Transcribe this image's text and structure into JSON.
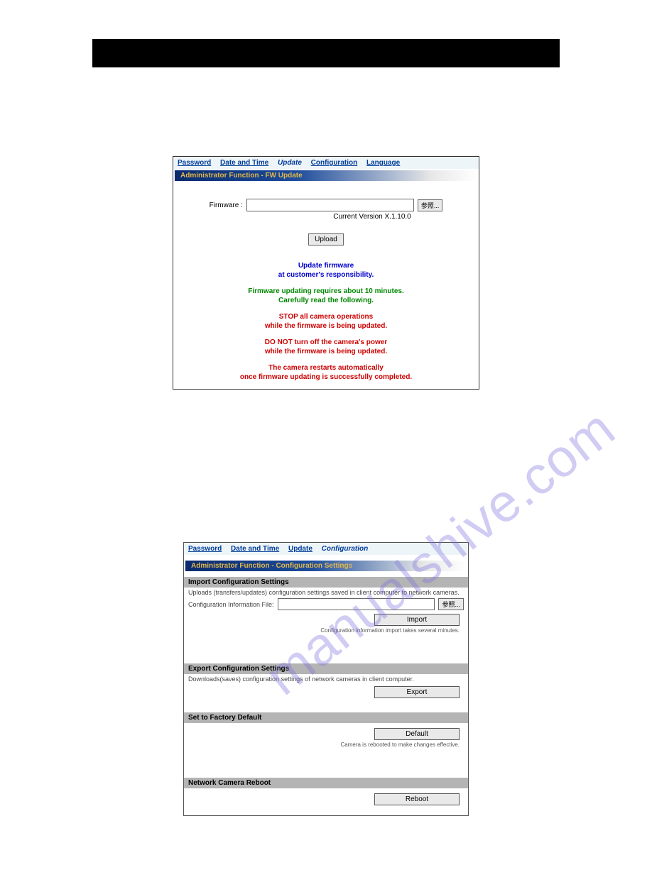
{
  "watermark": "manualshive.com",
  "panel1": {
    "tabs": [
      "Password",
      "Date and Time",
      "Update",
      "Configuration",
      "Language"
    ],
    "active_tab_index": 2,
    "header": "Administrator Function - FW Update",
    "firmware_label": "Firmware :",
    "browse_btn": "参照...",
    "version": "Current Version X.1.10.0",
    "upload_btn": "Upload",
    "msg_blue": "Update firmware\nat customer's responsibility.",
    "msg_green": "Firmware updating requires about 10 minutes.\nCarefully read the following.",
    "msg_red1": "STOP all camera operations\nwhile the firmware is being updated.",
    "msg_red2": "DO NOT turn off the camera's power\nwhile the firmware is being updated.",
    "msg_red3": "The camera restarts automatically\nonce firmware updating is successfully completed."
  },
  "panel2": {
    "tabs": [
      "Password",
      "Date and Time",
      "Update",
      "Configuration"
    ],
    "active_tab_index": 3,
    "header": "Administrator Function - Configuration Settings",
    "import_header": "Import Configuration Settings",
    "import_desc": "Uploads (transfers/updates) configuration settings saved in client computer to network cameras.",
    "config_file_label": "Configuration Information File:",
    "browse_btn": "参照...",
    "import_btn": "Import",
    "import_note": "Configuration information import takes several minutes.",
    "export_header": "Export Configuration Settings",
    "export_desc": "Downloads(saves) configuration settings of network cameras in client computer.",
    "export_btn": "Export",
    "default_header": "Set to Factory Default",
    "default_btn": "Default",
    "default_note": "Camera is rebooted to make changes effective.",
    "reboot_header": "Network Camera Reboot",
    "reboot_btn": "Reboot"
  }
}
